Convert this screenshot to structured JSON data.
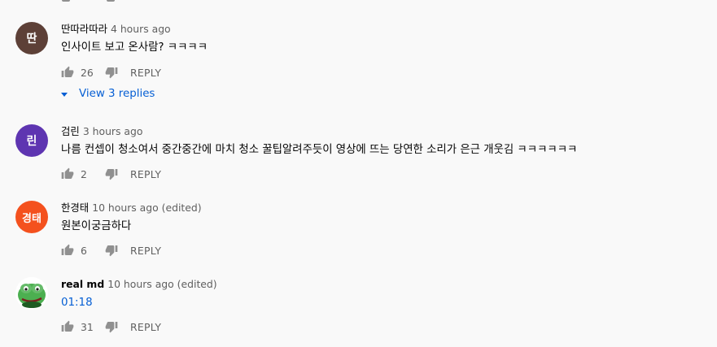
{
  "comments": [
    {
      "author": "딴따라따라",
      "avatar_text": "딴",
      "avatar_color": "#5d4037",
      "time": "4 hours ago",
      "text": "인사이트 보고 온사람? ㅋㅋㅋㅋ",
      "likes": "26",
      "reply_label": "REPLY",
      "view_replies": "View 3 replies"
    },
    {
      "author": "검린",
      "avatar_text": "린",
      "avatar_color": "#5e35b1",
      "time": "3 hours ago",
      "text": "나름 컨셉이 청소여서 중간중간에 마치 청소 꿀팁알려주듯이 영상에 뜨는 당연한 소리가 은근 개웃김 ㅋㅋㅋㅋㅋㅋ",
      "likes": "2",
      "reply_label": "REPLY"
    },
    {
      "author": "한경태",
      "avatar_text": "경태",
      "avatar_color": "#f4511e",
      "time": "10 hours ago (edited)",
      "text": "원본이궁금하다",
      "likes": "6",
      "reply_label": "REPLY"
    },
    {
      "author": "real md",
      "avatar_text": "",
      "avatar_color": "#2e7d32",
      "time": "10 hours ago (edited)",
      "text": "01:18",
      "likes": "31",
      "reply_label": "REPLY"
    }
  ]
}
